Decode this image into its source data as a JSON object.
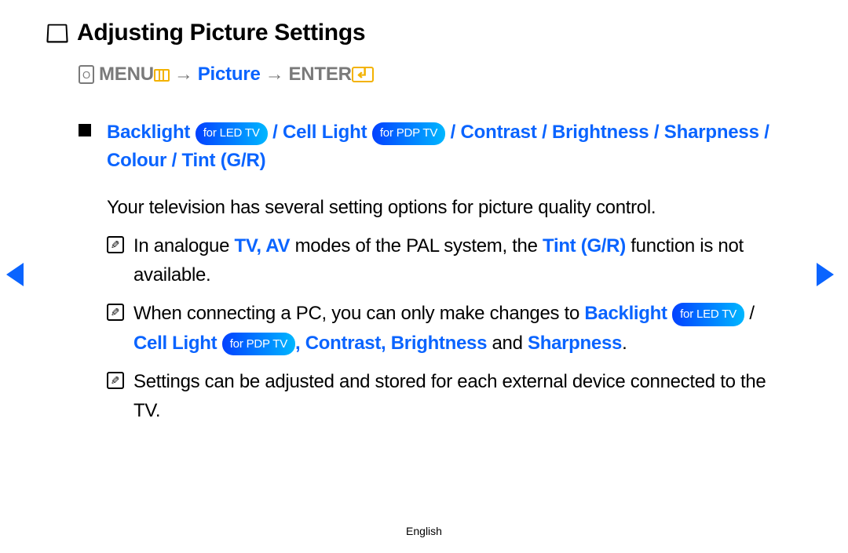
{
  "title": "Adjusting Picture Settings",
  "breadcrumb": {
    "menu": "MENU",
    "arrow": "→",
    "picture": "Picture",
    "enter": "ENTER"
  },
  "settings": {
    "backlight": "Backlight",
    "led_pill": "for LED TV",
    "cell_light": "Cell Light",
    "pdp_pill": "for PDP TV",
    "contrast": "Contrast",
    "brightness": "Brightness",
    "sharpness": "Sharpness",
    "colour": "Colour",
    "tint": "Tint (G/R)",
    "sep": " / "
  },
  "body": "Your television has several setting options for picture quality control.",
  "notes": {
    "n1_a": "In analogue ",
    "n1_b": "TV, AV",
    "n1_c": " modes of the PAL system, the ",
    "n1_d": "Tint (G/R)",
    "n1_e": " function is not available.",
    "n2_a": "When connecting a PC, you can only make changes to ",
    "n2_b": "Backlight",
    "n2_led": "for LED TV",
    "n2_c": " / ",
    "n2_d": "Cell Light",
    "n2_pdp": "for PDP TV",
    "n2_e": ", ",
    "n2_f": "Contrast, Brightness",
    "n2_g": " and ",
    "n2_h": "Sharpness",
    "n2_i": ".",
    "n3": "Settings can be adjusted and stored for each external device connected to the TV."
  },
  "footer": "English"
}
